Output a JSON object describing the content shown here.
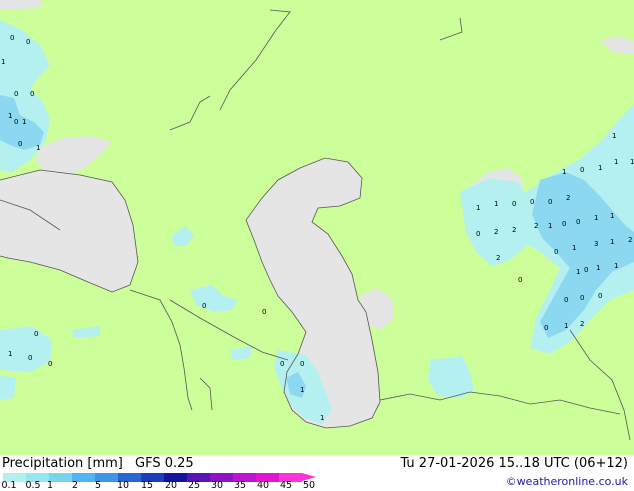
{
  "map": {
    "land_color": "#ccff99",
    "sea_color": "#e5e5e5",
    "light_precip_color": "#b4f0f0",
    "mid_precip_color": "#8cd8f0",
    "labels": {
      "west": [
        "0",
        "0",
        "0",
        "0",
        "1",
        "0",
        "1",
        "0",
        "1",
        "1"
      ],
      "caucasus": [
        "0",
        "0",
        "0",
        "1",
        "0",
        "0",
        "0",
        "0",
        "1"
      ],
      "east": [
        "1",
        "0",
        "1",
        "1",
        "1",
        "1",
        "2",
        "0",
        "0",
        "0",
        "1",
        "1",
        "1",
        "0",
        "0",
        "1",
        "1",
        "0",
        "2",
        "2",
        "2",
        "3",
        "1",
        "2",
        "0",
        "1",
        "2",
        "1",
        "0",
        "1",
        "1",
        "0",
        "0",
        "0",
        "0",
        "0",
        "1",
        "2",
        "1"
      ]
    }
  },
  "footer": {
    "title": "Precipitation [mm]",
    "model": "GFS 0.25",
    "validity": "Tu 27-01-2026 15..18 UTC (06+12)",
    "credit": "©weatheronline.co.uk",
    "legend": {
      "colors": [
        "#b4f0f0",
        "#96e6f0",
        "#78d2f0",
        "#50b4f0",
        "#3c96e6",
        "#2864d2",
        "#1e3cbe",
        "#1414a0",
        "#5a14b4",
        "#8c14c8",
        "#be14d2",
        "#e614d2",
        "#ff32dc"
      ],
      "ticks": [
        "0.1",
        "0.5",
        "1",
        "2",
        "5",
        "10",
        "15",
        "20",
        "25",
        "30",
        "35",
        "40",
        "45",
        "50"
      ]
    }
  }
}
